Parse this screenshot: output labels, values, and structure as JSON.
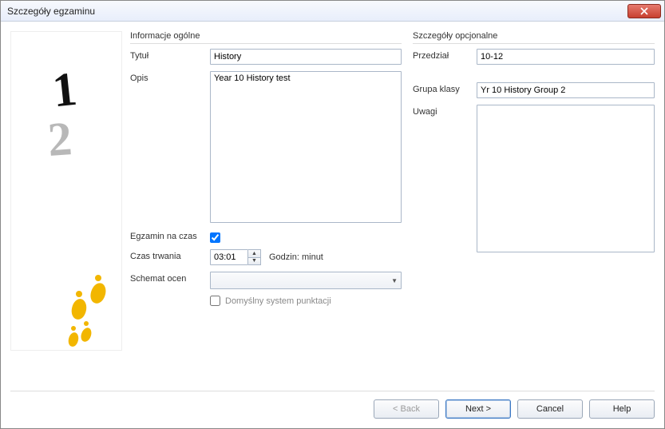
{
  "window": {
    "title": "Szczegóły egzaminu"
  },
  "general": {
    "legend": "Informacje ogólne",
    "title_label": "Tytuł",
    "title_value": "History",
    "desc_label": "Opis",
    "desc_value": "Year 10 History test",
    "timed_label": "Egzamin na czas",
    "timed_checked": true,
    "duration_label": "Czas trwania",
    "duration_value": "03:01",
    "duration_unit": "Godzin: minut",
    "scheme_label": "Schemat ocen",
    "scheme_value": "",
    "default_scoring_label": "Domyślny system punktacji",
    "default_scoring_checked": false
  },
  "optional": {
    "legend": "Szczegóły opcjonalne",
    "range_label": "Przedział",
    "range_value": "10-12",
    "group_label": "Grupa klasy",
    "group_value": "Yr 10 History Group 2",
    "notes_label": "Uwagi",
    "notes_value": ""
  },
  "footer": {
    "back": "< Back",
    "next": "Next >",
    "cancel": "Cancel",
    "help": "Help"
  }
}
